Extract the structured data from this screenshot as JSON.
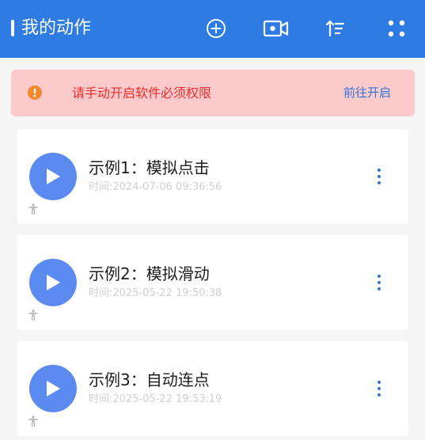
{
  "appbar": {
    "title": "我的动作",
    "icons": [
      "add-circle-icon",
      "video-camera-icon",
      "sort-icon",
      "grid-icon"
    ],
    "color": "#2e7be4"
  },
  "banner": {
    "message": "请手动开启软件必须权限",
    "action": "前往开启",
    "icon": "warning-circle-icon",
    "bg_color": "#fccacb",
    "text_color": "#ee2c2c",
    "link_color": "#2f72d8"
  },
  "actions": [
    {
      "title": "示例1：模拟点击",
      "time": "时间:2024-07-06 09:36:56"
    },
    {
      "title": "示例2：模拟滑动",
      "time": "时间:2025-05-22 19:50:38"
    },
    {
      "title": "示例3：自动连点",
      "time": "时间:2025-05-22 19:53:19"
    }
  ],
  "accent_color": "#5b8af0"
}
